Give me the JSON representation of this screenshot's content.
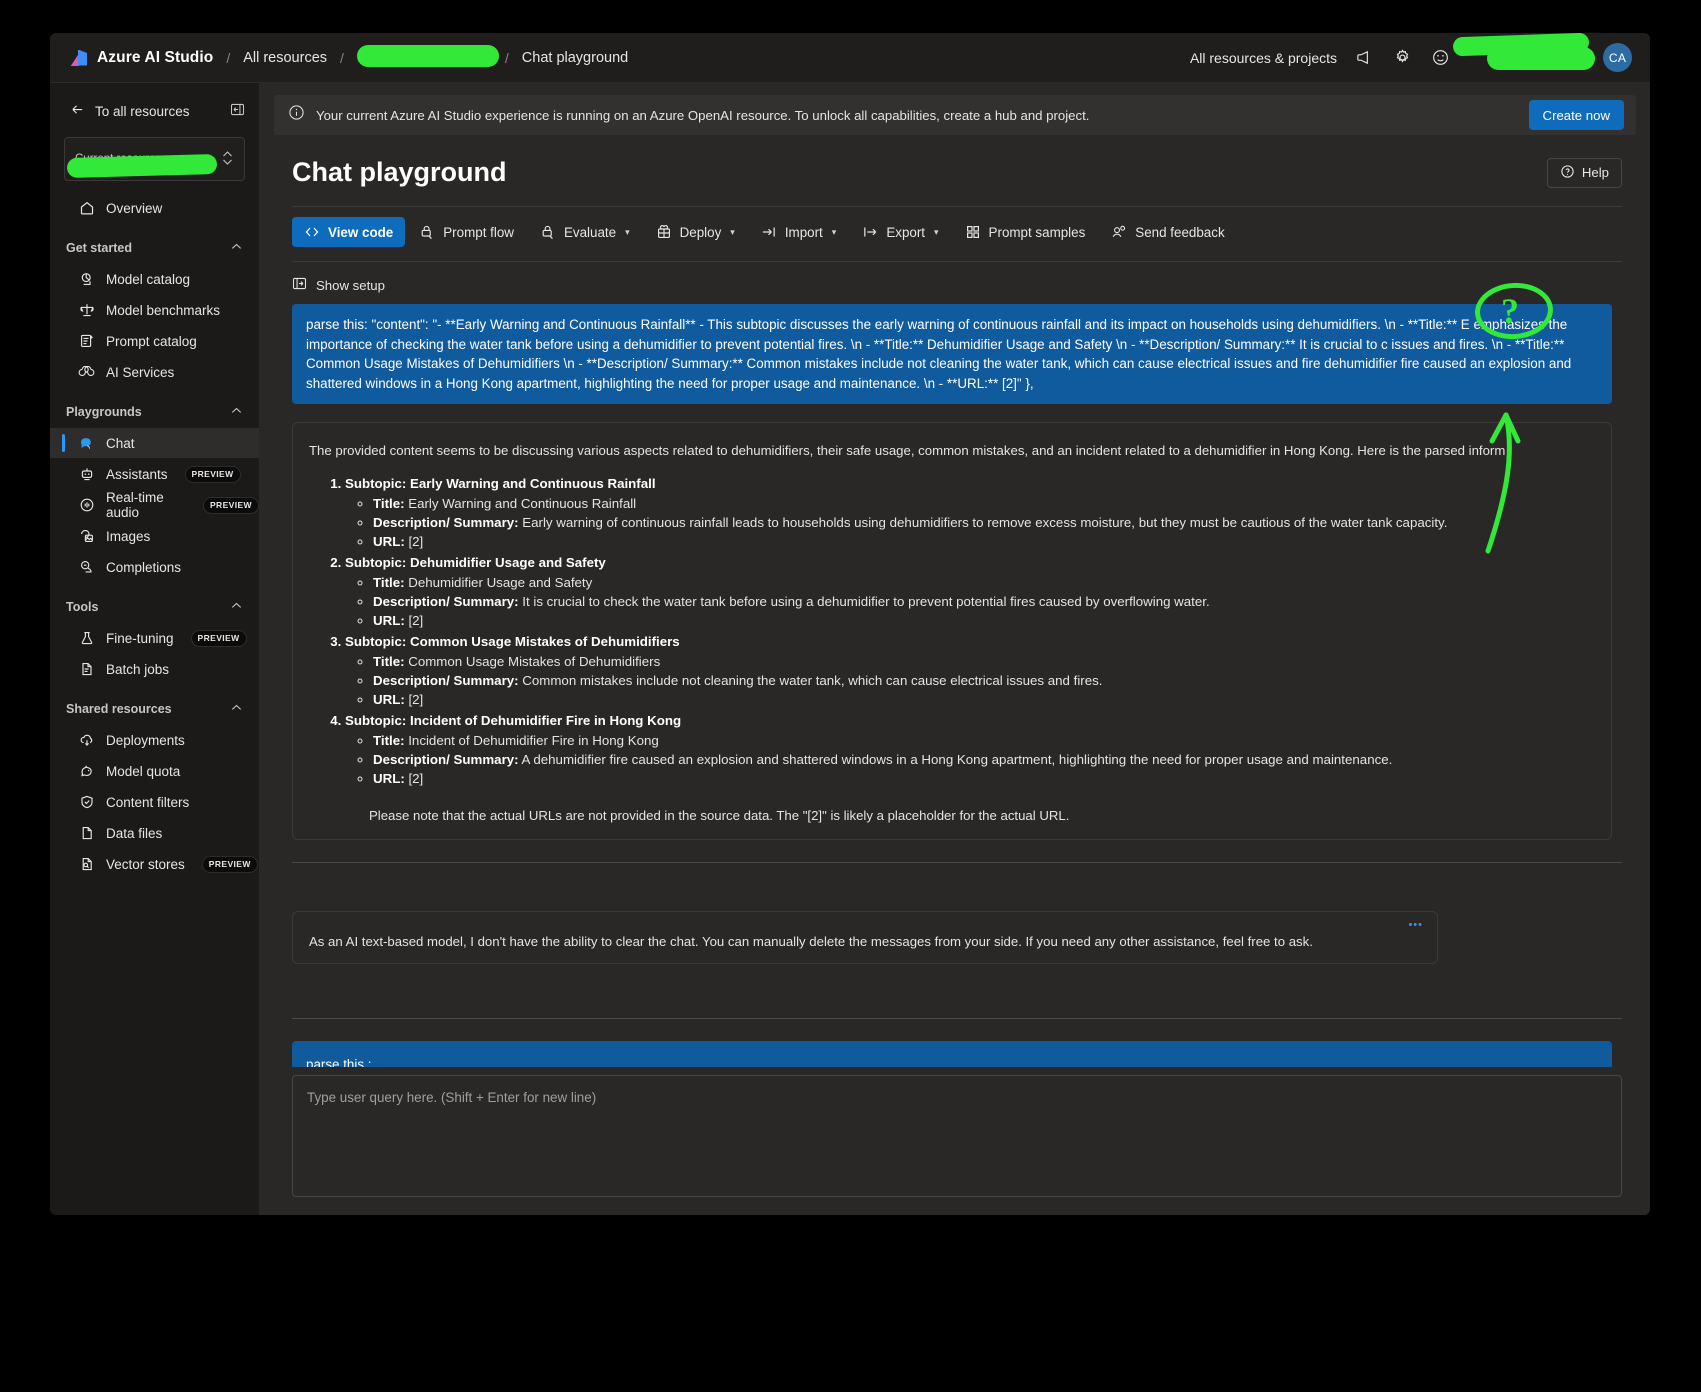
{
  "topbar": {
    "brand": "Azure AI Studio",
    "breadcrumbs": [
      "All resources",
      "",
      "Chat playground"
    ],
    "all_resources_link": "All resources & projects",
    "avatar_initials": "CA",
    "icons": [
      "megaphone-icon",
      "gear-icon",
      "smiley-icon"
    ]
  },
  "sidebar": {
    "back_label": "To all resources",
    "resource_picker_label": "Current resource",
    "overview_label": "Overview",
    "groups": [
      {
        "title": "Get started",
        "items": [
          {
            "label": "Model catalog",
            "badge": ""
          },
          {
            "label": "Model benchmarks",
            "badge": ""
          },
          {
            "label": "Prompt catalog",
            "badge": ""
          },
          {
            "label": "AI Services",
            "badge": ""
          }
        ]
      },
      {
        "title": "Playgrounds",
        "items": [
          {
            "label": "Chat",
            "badge": ""
          },
          {
            "label": "Assistants",
            "badge": "PREVIEW"
          },
          {
            "label": "Real-time audio",
            "badge": "PREVIEW"
          },
          {
            "label": "Images",
            "badge": ""
          },
          {
            "label": "Completions",
            "badge": ""
          }
        ]
      },
      {
        "title": "Tools",
        "items": [
          {
            "label": "Fine-tuning",
            "badge": "PREVIEW"
          },
          {
            "label": "Batch jobs",
            "badge": ""
          }
        ]
      },
      {
        "title": "Shared resources",
        "items": [
          {
            "label": "Deployments",
            "badge": ""
          },
          {
            "label": "Model quota",
            "badge": ""
          },
          {
            "label": "Content filters",
            "badge": ""
          },
          {
            "label": "Data files",
            "badge": ""
          },
          {
            "label": "Vector stores",
            "badge": "PREVIEW"
          }
        ]
      }
    ]
  },
  "banner": {
    "text": "Your current Azure AI Studio experience is running on an Azure OpenAI resource. To unlock all capabilities, create a hub and project.",
    "button": "Create now"
  },
  "page": {
    "title": "Chat playground",
    "help_label": "Help",
    "show_setup_label": "Show setup"
  },
  "commands": [
    {
      "label": "View code",
      "icon": "code-icon",
      "chevron": false,
      "selected": true
    },
    {
      "label": "Prompt flow",
      "icon": "prompt-flow-icon",
      "chevron": false,
      "selected": false
    },
    {
      "label": "Evaluate",
      "icon": "evaluate-icon",
      "chevron": true,
      "selected": false
    },
    {
      "label": "Deploy",
      "icon": "deploy-icon",
      "chevron": true,
      "selected": false
    },
    {
      "label": "Import",
      "icon": "import-icon",
      "chevron": true,
      "selected": false
    },
    {
      "label": "Export",
      "icon": "export-icon",
      "chevron": true,
      "selected": false
    },
    {
      "label": "Prompt samples",
      "icon": "grid-icon",
      "chevron": false,
      "selected": false
    },
    {
      "label": "Send feedback",
      "icon": "feedback-icon",
      "chevron": false,
      "selected": false
    }
  ],
  "chat": {
    "user_message_1": "parse this:        \"content\": \"- **Early Warning and Continuous Rainfall** - This subtopic discusses the early warning of continuous rainfall and its impact on households using dehumidifiers.  \\n  - **Title:** E emphasizes the importance of checking the water tank before using a dehumidifier to prevent potential fires.  \\n  - **Title:** Dehumidifier Usage and Safety  \\n  - **Description/ Summary:** It is crucial to c issues and fires.  \\n  - **Title:** Common Usage Mistakes of Dehumidifiers  \\n  - **Description/ Summary:** Common mistakes include not cleaning the water tank, which can cause electrical issues and fire dehumidifier fire caused an explosion and shattered windows in a Hong Kong apartment, highlighting the need for proper usage and maintenance.  \\n  - **URL:** [2]\"        },",
    "assistant_intro": "The provided content seems to be discussing various aspects related to dehumidifiers, their safe usage, common mistakes, and an incident related to a dehumidifier in Hong Kong. Here is the parsed inform",
    "parsed_items": [
      {
        "heading": "Subtopic: Early Warning and Continuous Rainfall",
        "title_label": "Title:",
        "title_value": "Early Warning and Continuous Rainfall",
        "desc_label": "Description/ Summary:",
        "desc_value": "Early warning of continuous rainfall leads to households using dehumidifiers to remove excess moisture, but they must be cautious of the water tank capacity.",
        "url_label": "URL:",
        "url_value": "[2]"
      },
      {
        "heading": "Subtopic: Dehumidifier Usage and Safety",
        "title_label": "Title:",
        "title_value": "Dehumidifier Usage and Safety",
        "desc_label": "Description/ Summary:",
        "desc_value": "It is crucial to check the water tank before using a dehumidifier to prevent potential fires caused by overflowing water.",
        "url_label": "URL:",
        "url_value": "[2]"
      },
      {
        "heading": "Subtopic: Common Usage Mistakes of Dehumidifiers",
        "title_label": "Title:",
        "title_value": "Common Usage Mistakes of Dehumidifiers",
        "desc_label": "Description/ Summary:",
        "desc_value": "Common mistakes include not cleaning the water tank, which can cause electrical issues and fires.",
        "url_label": "URL:",
        "url_value": "[2]"
      },
      {
        "heading": "Subtopic: Incident of Dehumidifier Fire in Hong Kong",
        "title_label": "Title:",
        "title_value": "Incident of Dehumidifier Fire in Hong Kong",
        "desc_label": "Description/ Summary:",
        "desc_value": "A dehumidifier fire caused an explosion and shattered windows in a Hong Kong apartment, highlighting the need for proper usage and maintenance.",
        "url_label": "URL:",
        "url_value": "[2]"
      }
    ],
    "assistant_note": "Please note that the actual URLs are not provided in the source data. The \"[2]\" is likely a placeholder for the actual URL.",
    "assistant_message_2": "As an AI text-based model, I don't have the ability to clear the chat. You can manually delete the messages from your side. If you need any other assistance, feel free to ask.",
    "user_message_2": "parse this :",
    "composer_placeholder": "Type user query here. (Shift + Enter for new line)"
  },
  "annotations": {
    "question_mark": "?",
    "highlight_color": "#32e839"
  }
}
